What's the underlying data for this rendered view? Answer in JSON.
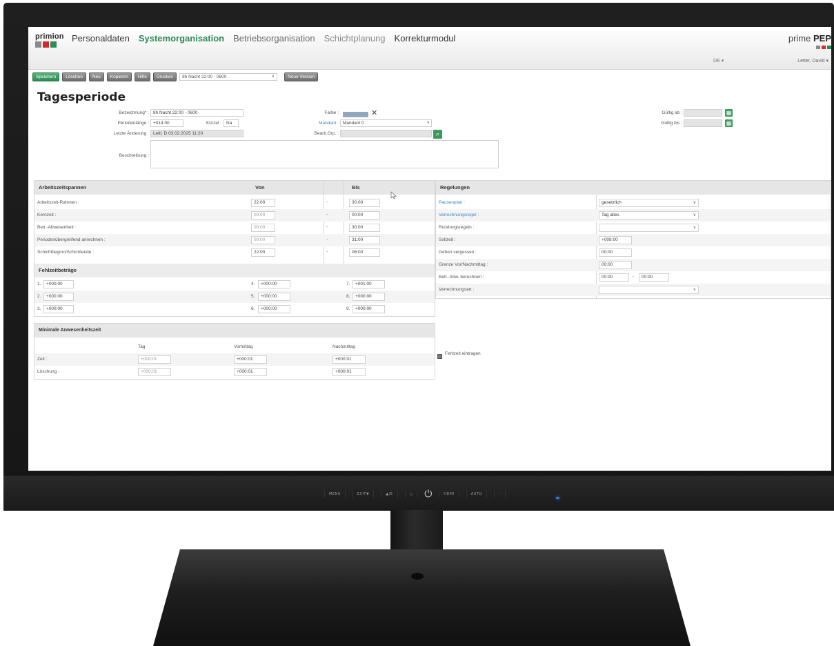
{
  "app": {
    "logo_text": "primion",
    "logo_colors": [
      "#8a8a8a",
      "#d42a2a",
      "#2e8b57"
    ],
    "brand_prefix": "prime ",
    "brand_bold": "PEP",
    "brand_colors": [
      "#8a8a8a",
      "#d42a2a",
      "#2e8b57"
    ],
    "nav": [
      "Personaldaten",
      "Systemorganisation",
      "Betriebsorganisation",
      "Schichtplanung",
      "Korrekturmodul"
    ],
    "active_nav": "Systemorganisation",
    "language": "DE",
    "user": "Letter, David"
  },
  "toolbar": {
    "save": "Speichern",
    "delete": "Löschen",
    "new": "Neu",
    "copy": "Kopieren",
    "help": "Hilfe",
    "print": "Drucken",
    "record_select": "8h Nacht 22:00 - 0600",
    "new_version": "Neue Version"
  },
  "page": {
    "title": "Tagesperiode"
  },
  "form": {
    "bezeichnung_label": "Bezeichnung* :",
    "bezeichnung_value": "8h Nacht 22:00 - 0600",
    "periodenlaenge_label": "Periodenlänge :",
    "periodenlaenge_value": "+014:00",
    "kuerzel_label": "Kürzel :",
    "kuerzel_value": "Na",
    "letzte_aenderung_label": "Letzte Änderung :",
    "letzte_aenderung_value": "Leitl, D 03.02.2025 11:20",
    "beschreibung_label": "Beschreibung :",
    "farbe_label": "Farbe :",
    "mandant_label": "Mandant :",
    "mandant_value": "Mandant 0",
    "bearb_grp_label": "Bearb.Grp. :",
    "gueltig_ab_label": "Gültig ab :",
    "gueltig_bis_label": "Gültig bis :"
  },
  "arbeitszeit": {
    "header": "Arbeitszeitspannen",
    "von_header": "Von",
    "bis_header": "Bis",
    "separator": "-",
    "rows": [
      {
        "label": "Arbeitszeit-Rahmen :",
        "von": "22:00",
        "bis": "30:00"
      },
      {
        "label": "Kernzeit :",
        "von": "00:00",
        "bis": "00:00"
      },
      {
        "label": "Betr.-Abwesenheit :",
        "von": "00:00",
        "bis": "30:00"
      },
      {
        "label": "Periodenübergreifend anrechnen :",
        "von": "00:00",
        "bis": "31:00"
      },
      {
        "label": "Schichtbeginn/Schichtende :",
        "von": "22:00",
        "bis": "06:00"
      }
    ]
  },
  "fehlzeit": {
    "header": "Fehlzeitbeträge",
    "rows": [
      [
        "1.",
        "+000:00",
        "4.",
        "+000:00",
        "7.",
        "+001:00"
      ],
      [
        "2.",
        "+000:00",
        "5.",
        "+000:00",
        "8.",
        "+000:00"
      ],
      [
        "3.",
        "+000:00",
        "6.",
        "+000:00",
        "9.",
        "+000:00"
      ]
    ]
  },
  "minimal": {
    "header": "Minimale Anwesenheitszeit",
    "columns": [
      "Tag",
      "Vormittag",
      "Nachmittag"
    ],
    "rows": [
      {
        "label": "Zeit :",
        "values": [
          "+000:01",
          "+000:01",
          "+000:01"
        ]
      },
      {
        "label": "Löschung :",
        "values": [
          "+000:01",
          "+000:01",
          "+000:01"
        ]
      }
    ]
  },
  "regelungen": {
    "header": "Regelungen",
    "rows": [
      {
        "label": "Pausenplan :",
        "value": "gesetzlich",
        "type": "select",
        "link": true
      },
      {
        "label": "Verrechnungsregel :",
        "value": "Tag alles",
        "type": "select",
        "link": true
      },
      {
        "label": "Rundungsregeln :",
        "value": "",
        "type": "select",
        "link": false
      },
      {
        "label": "Sollzeit :",
        "value": "+008:00",
        "type": "input",
        "link": false
      },
      {
        "label": "Gehen vergessen :",
        "value": "00:00",
        "type": "input",
        "link": false
      },
      {
        "label": "Grenze Vor/Nachmittag :",
        "value": "00:00",
        "type": "input",
        "link": false
      },
      {
        "label": "Betr.-Abw. berechnen :",
        "value": "00:00",
        "value2": "00:00",
        "type": "range",
        "link": false
      },
      {
        "label": "Verrechnungsart :",
        "value": "",
        "type": "select",
        "link": false
      }
    ]
  },
  "fehlzeit_eintragen": {
    "label": "Fehlzeit eintragen",
    "checked": true
  },
  "monitor": {
    "buttons": [
      "MENU",
      "EXIT▼",
      "▲/E"
    ],
    "buttons_right": [
      "HDMI",
      "AUTO"
    ]
  }
}
